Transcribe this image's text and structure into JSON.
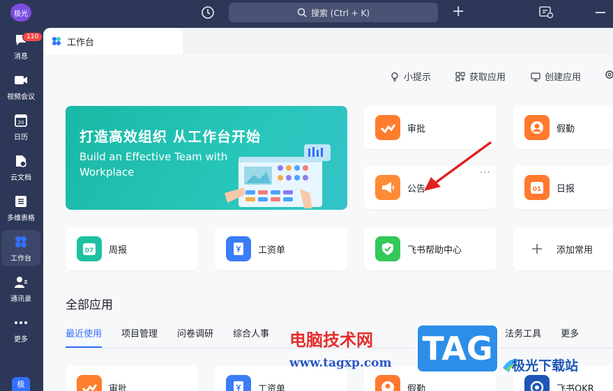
{
  "top": {
    "avatar": "极光",
    "search_label": "搜索 (Ctrl + K)"
  },
  "sidebar": {
    "badge": "110",
    "items": [
      {
        "label": "消息"
      },
      {
        "label": "视频会议"
      },
      {
        "label": "日历"
      },
      {
        "label": "云文档"
      },
      {
        "label": "多维表格"
      },
      {
        "label": "工作台"
      },
      {
        "label": "通讯录"
      },
      {
        "label": "更多"
      }
    ],
    "calendar_day": "20",
    "bottom": "极"
  },
  "tab": {
    "label": "工作台"
  },
  "toolbar": {
    "tips": "小提示",
    "get_app": "获取应用",
    "create_app": "创建应用"
  },
  "banner": {
    "title": "打造高效组织 从工作台开始",
    "subtitle": "Build an Effective Team with Workplace"
  },
  "apps": {
    "approval": "审批",
    "leave": "假勤",
    "notice": "公告",
    "daily": "日报",
    "weekly": "周报",
    "salary": "工资单",
    "help": "飞书帮助中心",
    "add": "添加常用",
    "daily_icon": "01",
    "weekly_icon": "07",
    "more_dots": "···"
  },
  "all_apps": {
    "title": "全部应用",
    "tabs": [
      "最近使用",
      "项目管理",
      "问卷调研",
      "综合人事",
      "",
      "",
      "",
      "",
      "法务工具",
      "更多"
    ]
  },
  "bottom_apps": {
    "approval": "审批",
    "salary": "工资单",
    "leave": "假勤",
    "okr": "飞书OKR"
  },
  "watermark": {
    "site_name": "电脑技术网",
    "url": "www.tagxp.com",
    "tag": "TAG",
    "logo_text": "极光下载站"
  },
  "colors": {
    "accent": "#3370ff",
    "sidebar_bg": "#2d3757",
    "banner": "#1fbcab",
    "arrow": "#e02020"
  }
}
